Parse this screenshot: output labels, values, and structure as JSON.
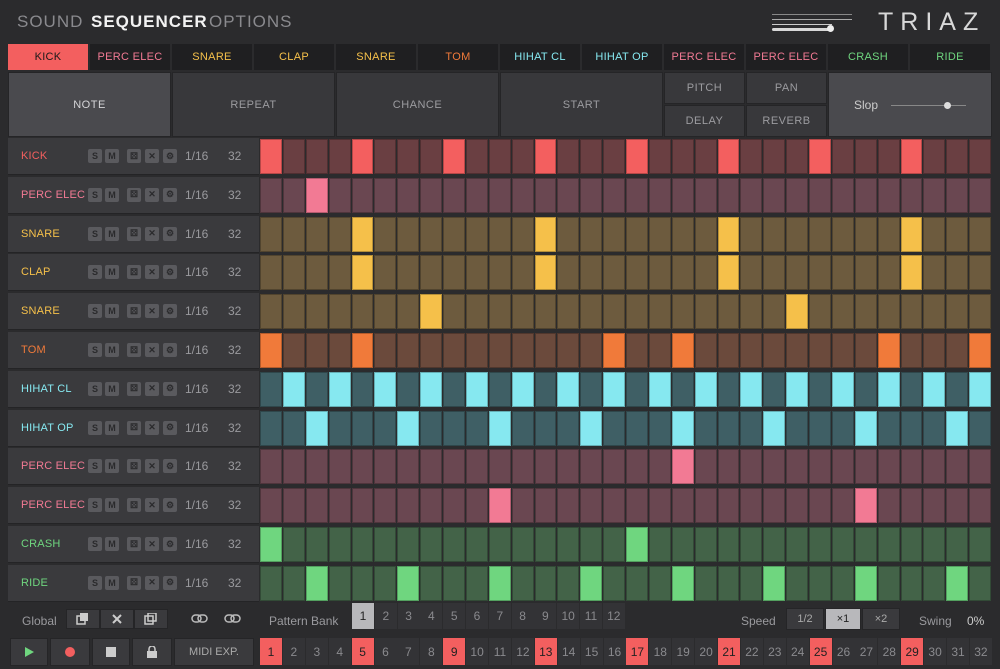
{
  "nav": {
    "tabs": [
      "SOUND",
      "SEQUENCER",
      "OPTIONS"
    ],
    "active": "SEQUENCER"
  },
  "logo": "TRIAZ",
  "tracks": [
    {
      "name": "KICK",
      "color": "#f35f5f"
    },
    {
      "name": "PERC ELEC",
      "color": "#f27a94"
    },
    {
      "name": "SNARE",
      "color": "#f5c04a"
    },
    {
      "name": "CLAP",
      "color": "#f5c04a"
    },
    {
      "name": "SNARE",
      "color": "#f5c04a"
    },
    {
      "name": "TOM",
      "color": "#f07a3a"
    },
    {
      "name": "HIHAT CL",
      "color": "#86e8f0"
    },
    {
      "name": "HIHAT OP",
      "color": "#86e8f0"
    },
    {
      "name": "PERC ELEC",
      "color": "#f27a94"
    },
    {
      "name": "PERC ELEC",
      "color": "#f27a94"
    },
    {
      "name": "CRASH",
      "color": "#6fd67f"
    },
    {
      "name": "RIDE",
      "color": "#6fd67f"
    }
  ],
  "params": {
    "note": "NOTE",
    "repeat": "REPEAT",
    "chance": "CHANCE",
    "start": "START",
    "pitch": "PITCH",
    "pan": "PAN",
    "delay": "DELAY",
    "reverb": "REVERB",
    "slop": "Slop"
  },
  "rows": [
    {
      "name": "KICK",
      "division": "1/16",
      "length": "32",
      "color": "#f35f5f",
      "bg": "#6a3f42",
      "steps": [
        1,
        5,
        9,
        13,
        17,
        21,
        25,
        29
      ]
    },
    {
      "name": "PERC ELEC",
      "division": "1/16",
      "length": "32",
      "color": "#f27a94",
      "bg": "#6a4751",
      "steps": [
        3
      ]
    },
    {
      "name": "SNARE",
      "division": "1/16",
      "length": "32",
      "color": "#f5c04a",
      "bg": "#6d5b3e",
      "steps": [
        5,
        13,
        21,
        29
      ]
    },
    {
      "name": "CLAP",
      "division": "1/16",
      "length": "32",
      "color": "#f5c04a",
      "bg": "#6d5b3e",
      "steps": [
        5,
        13,
        21,
        29
      ]
    },
    {
      "name": "SNARE",
      "division": "1/16",
      "length": "32",
      "color": "#f5c04a",
      "bg": "#6d5b3e",
      "steps": [
        8,
        24
      ]
    },
    {
      "name": "TOM",
      "division": "1/16",
      "length": "32",
      "color": "#f07a3a",
      "bg": "#6b4a3c",
      "steps": [
        1,
        5,
        16,
        19,
        28,
        32
      ]
    },
    {
      "name": "HIHAT CL",
      "division": "1/16",
      "length": "32",
      "color": "#86e8f0",
      "bg": "#3f5f65",
      "steps": [
        2,
        4,
        6,
        8,
        10,
        12,
        14,
        16,
        18,
        20,
        22,
        24,
        26,
        28,
        30,
        32
      ]
    },
    {
      "name": "HIHAT OP",
      "division": "1/16",
      "length": "32",
      "color": "#86e8f0",
      "bg": "#3f5f65",
      "steps": [
        3,
        7,
        11,
        15,
        19,
        23,
        27,
        31
      ]
    },
    {
      "name": "PERC ELEC",
      "division": "1/16",
      "length": "32",
      "color": "#f27a94",
      "bg": "#6a4751",
      "steps": [
        19
      ]
    },
    {
      "name": "PERC ELEC",
      "division": "1/16",
      "length": "32",
      "color": "#f27a94",
      "bg": "#6a4751",
      "steps": [
        11,
        27
      ]
    },
    {
      "name": "CRASH",
      "division": "1/16",
      "length": "32",
      "color": "#6fd67f",
      "bg": "#436348",
      "steps": [
        1,
        17
      ]
    },
    {
      "name": "RIDE",
      "division": "1/16",
      "length": "32",
      "color": "#6fd67f",
      "bg": "#436348",
      "steps": [
        3,
        7,
        11,
        15,
        19,
        23,
        27,
        31
      ]
    }
  ],
  "bottom": {
    "global": "Global",
    "pattern_bank": "Pattern Bank",
    "patterns": [
      "1",
      "2",
      "3",
      "4",
      "5",
      "6",
      "7",
      "8",
      "9",
      "10",
      "11",
      "12"
    ],
    "active_pattern": "1",
    "speed_label": "Speed",
    "speeds": [
      "1/2",
      "×1",
      "×2"
    ],
    "active_speed": "×1",
    "swing_label": "Swing",
    "swing_value": "0%",
    "midi_exp": "MIDI EXP.",
    "steps": [
      "1",
      "2",
      "3",
      "4",
      "5",
      "6",
      "7",
      "8",
      "9",
      "10",
      "11",
      "12",
      "13",
      "14",
      "15",
      "16",
      "17",
      "18",
      "19",
      "20",
      "21",
      "22",
      "23",
      "24",
      "25",
      "26",
      "27",
      "28",
      "29",
      "30",
      "31",
      "32"
    ],
    "highlighted_steps": [
      1,
      5,
      9,
      13,
      17,
      21,
      25,
      29
    ]
  },
  "icons": [
    "duplicate-icon",
    "clear-icon",
    "copy-icon",
    "link-icon",
    "unlink-icon",
    "play-icon",
    "record-icon",
    "stop-icon",
    "lock-icon",
    "dice-icon",
    "close-icon",
    "gear-icon"
  ]
}
